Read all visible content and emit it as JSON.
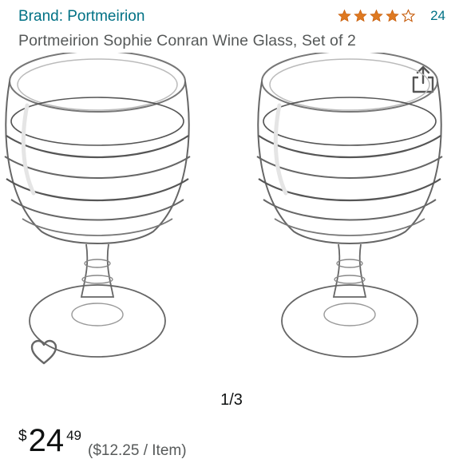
{
  "product": {
    "brand": "Brand: Portmeirion",
    "title": "Portmeirion Sophie Conran Wine Glass, Set of 2",
    "rating": {
      "stars": 4.0,
      "count": "24",
      "star_color": "#de7921"
    }
  },
  "gallery": {
    "counter": "1/3"
  },
  "price": {
    "symbol": "$",
    "whole": "24",
    "fraction": "49",
    "unit_price": "($12.25 / Item)"
  },
  "colors": {
    "link": "#007185",
    "muted": "#565959",
    "text": "#0f1111",
    "glass_line": "#6b6b6b"
  },
  "icons": {
    "share": "share-icon",
    "wishlist": "heart-outline-icon",
    "star": "star-icon"
  }
}
